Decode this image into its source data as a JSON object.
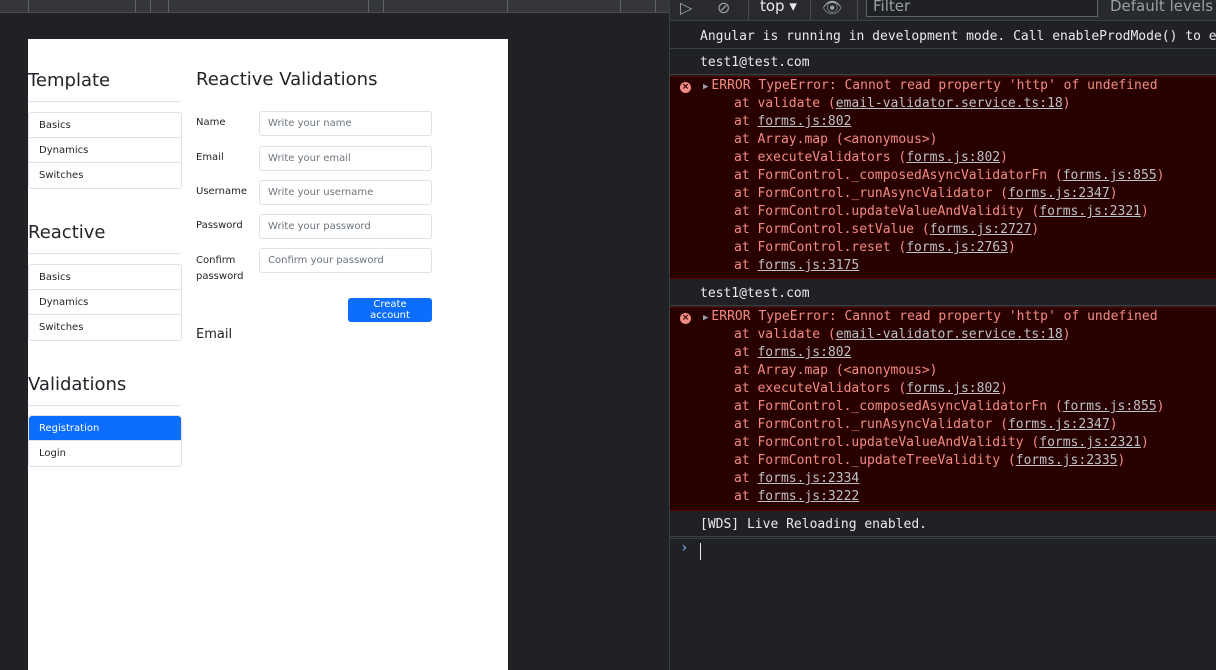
{
  "app": {
    "sidebar": {
      "groups": [
        {
          "title": "Template",
          "items": [
            "Basics",
            "Dynamics",
            "Switches"
          ]
        },
        {
          "title": "Reactive",
          "items": [
            "Basics",
            "Dynamics",
            "Switches"
          ]
        },
        {
          "title": "Validations",
          "items": [
            "Registration",
            "Login"
          ],
          "active": "Registration"
        }
      ]
    },
    "form": {
      "title": "Reactive Validations",
      "fields": [
        {
          "label": "Name",
          "placeholder": "Write your name"
        },
        {
          "label": "Email",
          "placeholder": "Write your email"
        },
        {
          "label": "Username",
          "placeholder": "Write your username"
        },
        {
          "label": "Password",
          "placeholder": "Write your password"
        },
        {
          "label": "Confirm password",
          "placeholder": "Confirm your password"
        }
      ],
      "submit_label": "Create account",
      "echo_label": "Email"
    }
  },
  "devtools": {
    "toolbar": {
      "context": "top ▾",
      "filter_placeholder": "Filter",
      "levels": "Default levels ▾"
    },
    "console": {
      "info": "Angular is running in development mode. Call enableProdMode() to enable production mode.",
      "log1": "test1@test.com",
      "error1": {
        "message": "ERROR TypeError: Cannot read property 'http' of undefined",
        "frames": [
          [
            "at validate (",
            "email-validator.service.ts:18",
            ")"
          ],
          [
            "at ",
            "forms.js:802",
            ""
          ],
          [
            "at Array.map (<anonymous>)",
            "",
            ""
          ],
          [
            "at executeValidators (",
            "forms.js:802",
            ")"
          ],
          [
            "at FormControl._composedAsyncValidatorFn (",
            "forms.js:855",
            ")"
          ],
          [
            "at FormControl._runAsyncValidator (",
            "forms.js:2347",
            ")"
          ],
          [
            "at FormControl.updateValueAndValidity (",
            "forms.js:2321",
            ")"
          ],
          [
            "at FormControl.setValue (",
            "forms.js:2727",
            ")"
          ],
          [
            "at FormControl.reset (",
            "forms.js:2763",
            ")"
          ],
          [
            "at ",
            "forms.js:3175",
            ""
          ]
        ]
      },
      "log2": "test1@test.com",
      "error2": {
        "message": "ERROR TypeError: Cannot read property 'http' of undefined",
        "frames": [
          [
            "at validate (",
            "email-validator.service.ts:18",
            ")"
          ],
          [
            "at ",
            "forms.js:802",
            ""
          ],
          [
            "at Array.map (<anonymous>)",
            "",
            ""
          ],
          [
            "at executeValidators (",
            "forms.js:802",
            ")"
          ],
          [
            "at FormControl._composedAsyncValidatorFn (",
            "forms.js:855",
            ")"
          ],
          [
            "at FormControl._runAsyncValidator (",
            "forms.js:2347",
            ")"
          ],
          [
            "at FormControl.updateValueAndValidity (",
            "forms.js:2321",
            ")"
          ],
          [
            "at FormControl._updateTreeValidity (",
            "forms.js:2335",
            ")"
          ],
          [
            "at ",
            "forms.js:2334",
            ""
          ],
          [
            "at ",
            "forms.js:3222",
            ""
          ]
        ]
      },
      "wds": "[WDS] Live Reloading enabled.",
      "prompt": "›"
    }
  }
}
